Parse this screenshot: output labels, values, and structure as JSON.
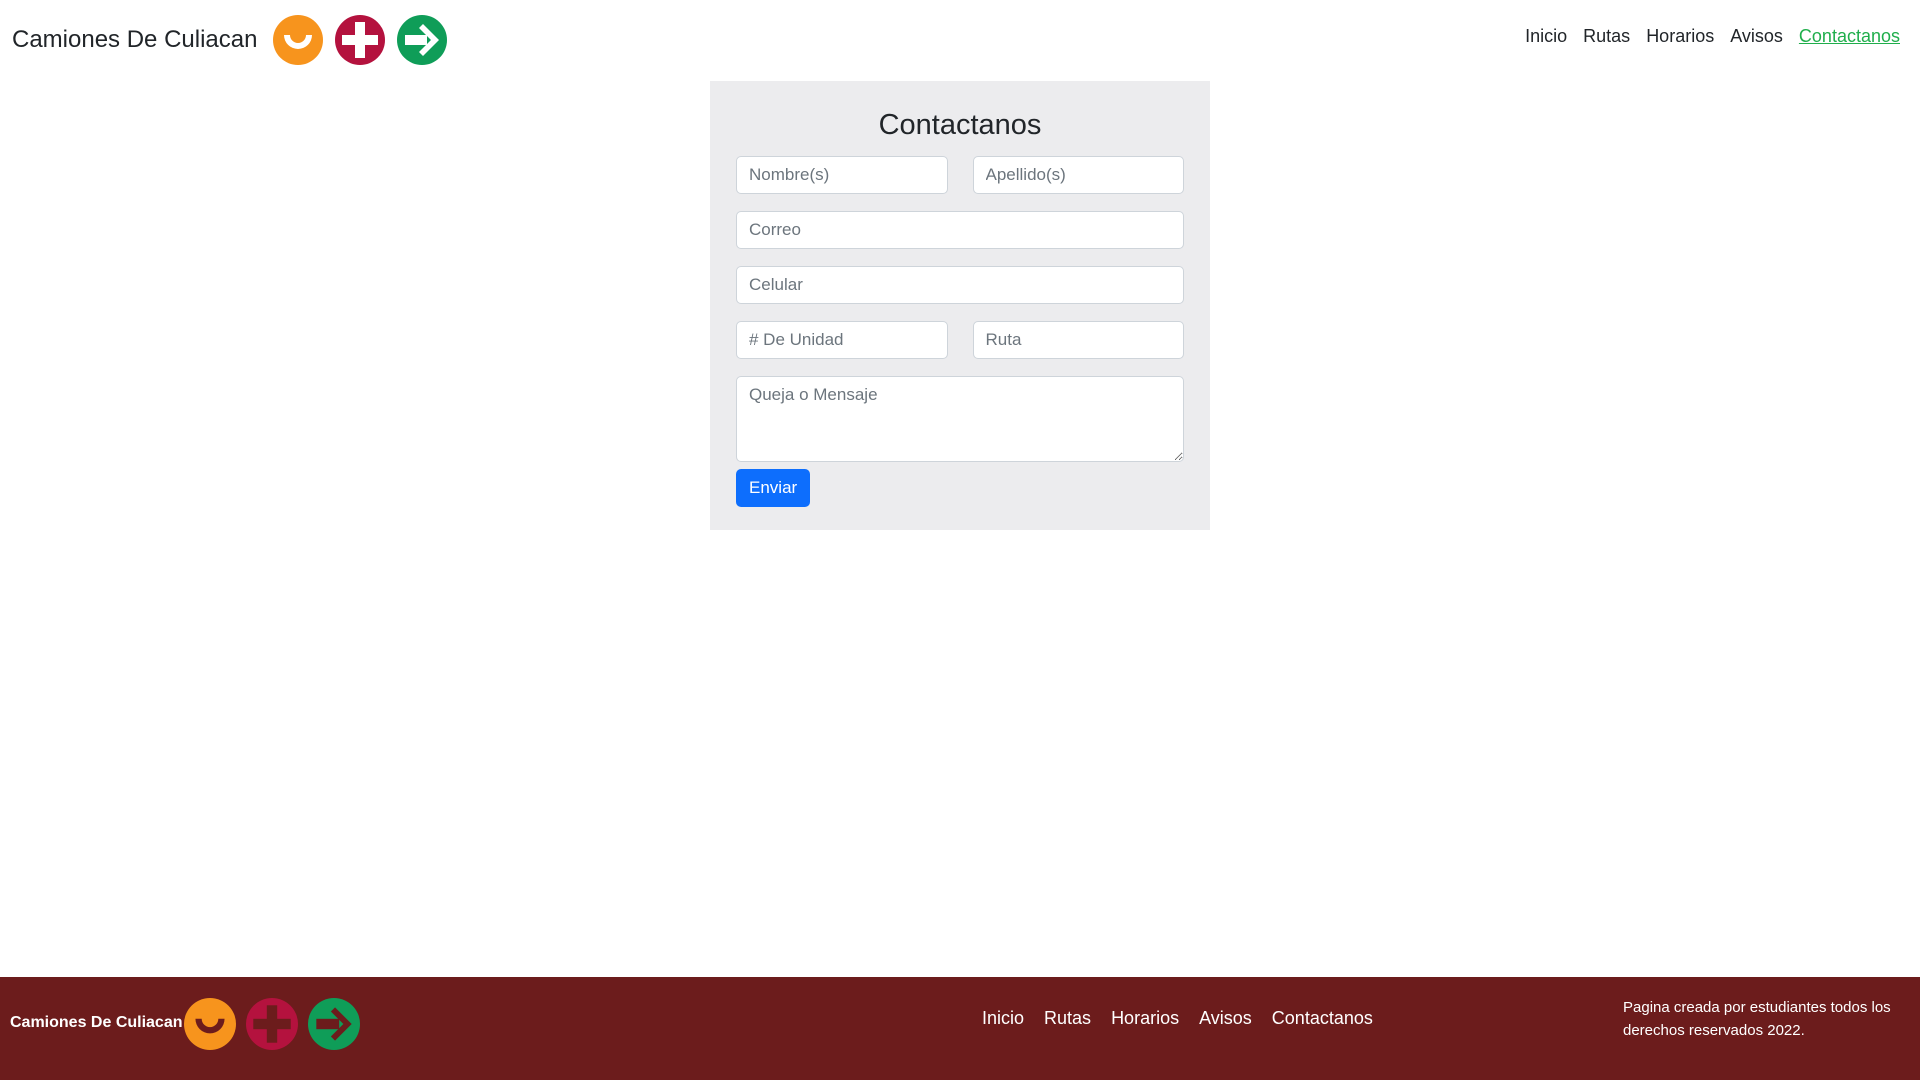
{
  "brand": {
    "title": "Camiones De Culiacan"
  },
  "logos": [
    "orange-smile-icon",
    "red-plus-icon",
    "green-arrow-icon"
  ],
  "colors": {
    "orange": "#f7941d",
    "red": "#b4123e",
    "green": "#0f9d58",
    "footer_bg": "#6c1c1c",
    "primary": "#0d6efd",
    "active_link": "#1fae4b"
  },
  "nav": {
    "links": [
      "Inicio",
      "Rutas",
      "Horarios",
      "Avisos",
      "Contactanos"
    ],
    "active": "Contactanos"
  },
  "form": {
    "title": "Contactanos",
    "placeholders": {
      "nombre": "Nombre(s)",
      "apellido": "Apellido(s)",
      "correo": "Correo",
      "celular": "Celular",
      "unidad": "# De Unidad",
      "ruta": "Ruta",
      "mensaje": "Queja o Mensaje"
    },
    "submit_label": "Enviar"
  },
  "footer": {
    "brand": "Camiones De Culiacan",
    "links": [
      "Inicio",
      "Rutas",
      "Horarios",
      "Avisos",
      "Contactanos"
    ],
    "note": "Pagina creada por estudiantes todos los derechos reservados 2022."
  }
}
